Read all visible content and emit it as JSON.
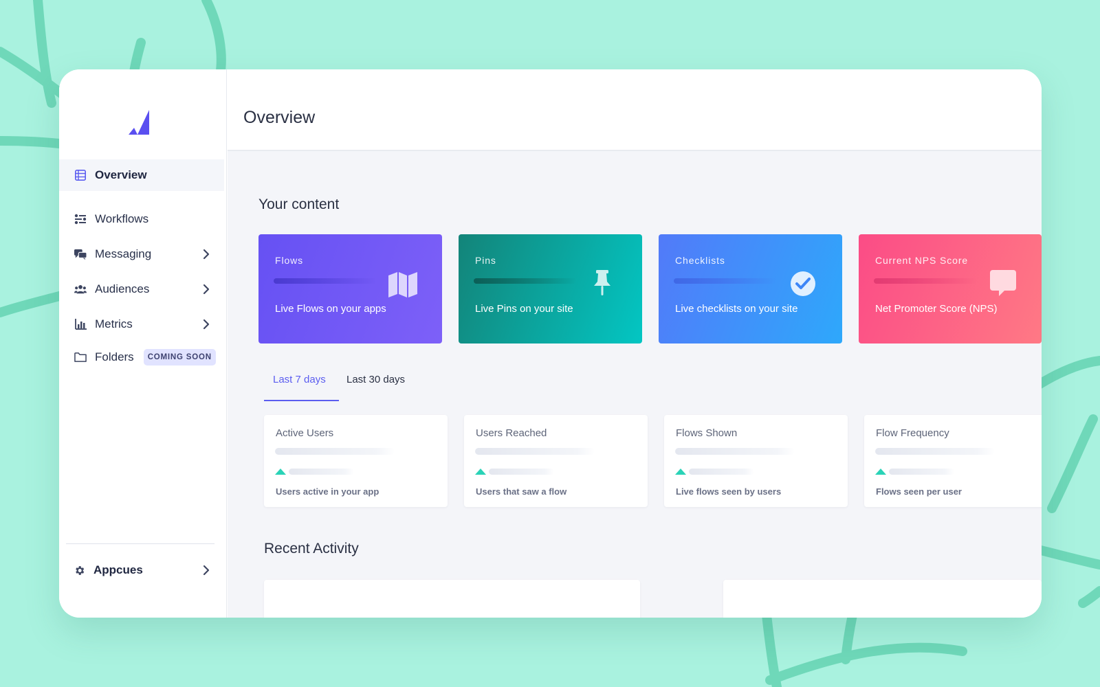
{
  "sidebar": {
    "logo": "appcues-logo",
    "items": [
      {
        "label": "Overview",
        "icon": "table-list-icon",
        "active": true
      },
      {
        "label": "Workflows",
        "icon": "workflows-icon"
      },
      {
        "label": "Messaging",
        "icon": "comments-icon",
        "has_submenu": true
      },
      {
        "label": "Audiences",
        "icon": "users-icon",
        "has_submenu": true
      },
      {
        "label": "Metrics",
        "icon": "bar-chart-icon",
        "has_submenu": true
      },
      {
        "label": "Folders",
        "icon": "folder-icon",
        "badge": "COMING SOON"
      }
    ],
    "account": {
      "label": "Appcues",
      "icon": "gear-icon"
    }
  },
  "header": {
    "title": "Overview"
  },
  "content_section": {
    "title": "Your content",
    "cards": [
      {
        "title": "Flows",
        "description": "Live Flows on your apps",
        "icon": "map-icon",
        "gradient": [
          "#6651f3",
          "#7a5cf7"
        ]
      },
      {
        "title": "Pins",
        "description": "Live Pins on your site",
        "icon": "pin-icon",
        "gradient": [
          "#128c80",
          "#04c2c0"
        ]
      },
      {
        "title": "Checklists",
        "description": "Live checklists on your site",
        "icon": "check-circle-icon",
        "gradient": [
          "#4f7cf9",
          "#2fa6fb"
        ]
      },
      {
        "title": "Current NPS Score",
        "description": "Net Promoter Score (NPS)",
        "icon": "speech-bubble-icon",
        "gradient": [
          "#fb4e86",
          "#ff7684"
        ]
      }
    ]
  },
  "tabs": [
    {
      "label": "Last 7 days",
      "active": true
    },
    {
      "label": "Last 30 days",
      "active": false
    }
  ],
  "stats": [
    {
      "title": "Active Users",
      "description": "Users active in your app"
    },
    {
      "title": "Users Reached",
      "description": "Users that saw a flow"
    },
    {
      "title": "Flows Shown",
      "description": "Live flows seen by users"
    },
    {
      "title": "Flow Frequency",
      "description": "Flows seen per user"
    }
  ],
  "activity": {
    "title": "Recent Activity"
  },
  "colors": {
    "background": "#a9f2df",
    "accent": "#5b5df0",
    "trend_up": "#2ad3b7"
  }
}
